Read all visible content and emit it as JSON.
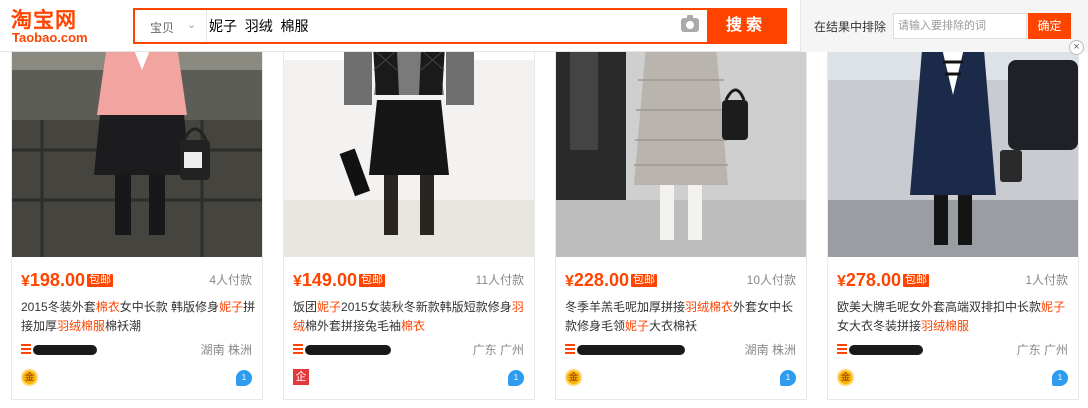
{
  "header": {
    "logo_cn": "淘宝网",
    "logo_en": "Taobao.com",
    "search": {
      "category": "宝贝",
      "query": "妮子  羽绒  棉服",
      "button": "搜索"
    },
    "filter": {
      "label": "在结果中排除",
      "placeholder": "请输入要排除的词",
      "button": "确定"
    },
    "close_symbol": "×"
  },
  "colors": {
    "accent": "#ff4400"
  },
  "badge_baoyou": "包邮",
  "currency": "¥",
  "products": [
    {
      "price": "198.00",
      "paid": "4人付款",
      "title_parts": [
        "2015冬装外套",
        "棉衣",
        "女中长款 韩版修身",
        "妮子",
        "拼接加厚",
        "羽绒棉服",
        "棉袄潮"
      ],
      "location": "湖南 株洲",
      "seller_badge": "金",
      "seller_badge_type": "gold"
    },
    {
      "price": "149.00",
      "paid": "11人付款",
      "title_parts": [
        "饭团",
        "妮子",
        "2015女装秋冬新款韩版短款修身",
        "羽绒",
        "棉外套拼接兔毛袖",
        "棉衣",
        ""
      ],
      "location": "广东 广州",
      "seller_badge": "企",
      "seller_badge_type": "enterprise"
    },
    {
      "price": "228.00",
      "paid": "10人付款",
      "title_parts": [
        "冬季羊羔毛呢加厚拼接",
        "羽绒棉衣",
        "外套女中长款修身毛领",
        "妮子",
        "大衣棉袄",
        "",
        ""
      ],
      "location": "湖南 株洲",
      "seller_badge": "金",
      "seller_badge_type": "gold"
    },
    {
      "price": "278.00",
      "paid": "1人付款",
      "title_parts": [
        "欧美大牌毛呢女外套高端双排扣中长款",
        "妮子",
        "女大衣冬装拼接",
        "羽绒棉服",
        "",
        "",
        ""
      ],
      "location": "广东 广州",
      "seller_badge": "金",
      "seller_badge_type": "gold"
    }
  ]
}
